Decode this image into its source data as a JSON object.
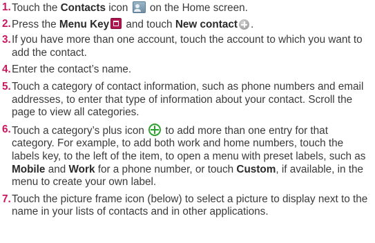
{
  "steps": [
    {
      "num": "1.",
      "parts": [
        "Touch the ",
        "Contacts",
        " icon ",
        " on the Home screen."
      ]
    },
    {
      "num": "2.",
      "parts": [
        "Press the ",
        "Menu Key",
        " and touch ",
        "New contact",
        "."
      ]
    },
    {
      "num": "3.",
      "text": "If you have more than one account, touch the account to which you want to add the contact."
    },
    {
      "num": "4.",
      "text": "Enter the contact’s name."
    },
    {
      "num": "5.",
      "text": "Touch a category of contact information, such as phone numbers and email addresses, to enter that type of information about your contact. Scroll the page to view all categories."
    },
    {
      "num": "6.",
      "parts": [
        "Touch a category’s plus icon ",
        " to add more than one entry for that category. For example, to add both work and home numbers, touch the labels key, to the left of the item, to open a menu with preset labels, such as ",
        "Mobile",
        " and ",
        "Work",
        " for a phone number, or touch ",
        "Custom",
        ", if available, in the menu to create your own label."
      ]
    },
    {
      "num": "7.",
      "text": "Touch the picture frame icon (below) to select a picture to display next to the name in your lists of contacts and in other applications."
    }
  ],
  "icons": {
    "contacts": "contacts-icon",
    "menu_key": "menu-key-icon",
    "new_contact": "new-contact-plus-icon",
    "category_plus": "green-plus-circle-icon"
  },
  "colors": {
    "step_number": "#c8175e",
    "body_text": "#3a3a3a",
    "plus_icon": "#2aa32a"
  }
}
